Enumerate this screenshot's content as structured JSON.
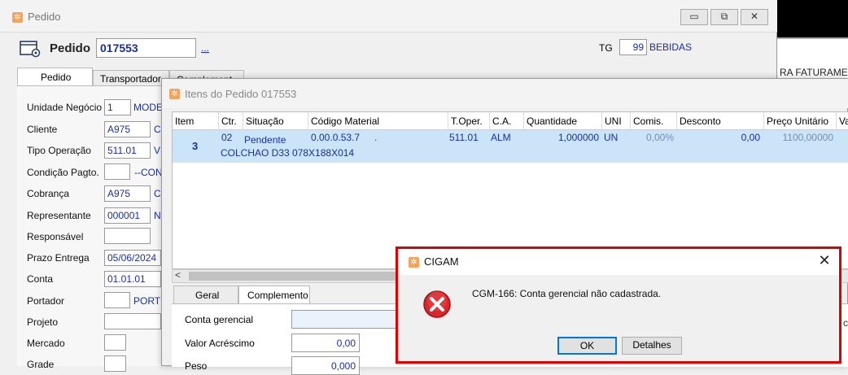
{
  "background": {
    "side_text": "RA FATURAMEN"
  },
  "main": {
    "title": "Pedido",
    "icon": "app-logo-icon",
    "buttons": {
      "minimize": "▭",
      "restore": "⧉",
      "close": "✕"
    },
    "header": {
      "label": "Pedido",
      "number": "017553",
      "lookup": "...",
      "tg_label": "TG",
      "tg_value": "99",
      "tg_desc": "BEBIDAS"
    },
    "tabs": [
      {
        "label": "Pedido"
      },
      {
        "label": "Transportador"
      },
      {
        "label": "Complement"
      }
    ],
    "fields": [
      {
        "label": "Unidade Negócio",
        "value": "1",
        "desc": "MODE"
      },
      {
        "label": "Cliente",
        "value": "A975",
        "desc": "C"
      },
      {
        "label": "Tipo Operação",
        "value": "511.01",
        "desc": "V"
      },
      {
        "label": "Condição Pagto.",
        "value": "",
        "desc": "--CON"
      },
      {
        "label": "Cobrança",
        "value": "A975",
        "desc": "C"
      },
      {
        "label": "Representante",
        "value": "000001",
        "desc": "N"
      },
      {
        "label": "Responsável",
        "value": "",
        "desc": ""
      },
      {
        "label": "Prazo Entrega",
        "value": "05/06/2024",
        "desc": ""
      },
      {
        "label": "Conta",
        "value": "01.01.01",
        "desc": ""
      },
      {
        "label": "Portador",
        "value": "",
        "desc": "PORT"
      },
      {
        "label": "Projeto",
        "value": "",
        "desc": ""
      },
      {
        "label": "Mercado",
        "value": "",
        "desc": ""
      },
      {
        "label": "Grade",
        "value": "",
        "desc": ""
      }
    ]
  },
  "items": {
    "title": "Itens do Pedido 017553",
    "columns": [
      "Item",
      "Ctr.",
      "Situação",
      "Código Material",
      "T.Oper.",
      "C.A.",
      "Quantidade",
      "UNI",
      "Comis.",
      "Desconto",
      "Preço Unitário",
      "Va"
    ],
    "row": {
      "item": "3",
      "ctr": "02",
      "situacao": "Pendente",
      "codigo": "0.00.0.53.7",
      "codigo_dot": ".",
      "toper": "511.01",
      "ca": "ALM",
      "quantidade": "1,000000",
      "uni": "UN",
      "comis": "0,00%",
      "desconto": "0,00",
      "preco": "1100,00000",
      "descricao": "COLCHAO D33 078X188X014"
    },
    "scroll_left": "<",
    "bottom_tabs": [
      {
        "label": "Geral"
      },
      {
        "label": "Complemento"
      }
    ],
    "bottom_fields": [
      {
        "label": "Conta gerencial",
        "value": ""
      },
      {
        "label": "Valor Acréscimo",
        "value": "0,00"
      },
      {
        "label": "Peso",
        "value": "0,000"
      }
    ]
  },
  "dialog": {
    "title": "CIGAM",
    "close": "✕",
    "message": "CGM-166: Conta gerencial não cadastrada.",
    "ok": "OK",
    "details": "Detalhes",
    "edge_char": "c",
    "error_color": "#d9262b"
  }
}
